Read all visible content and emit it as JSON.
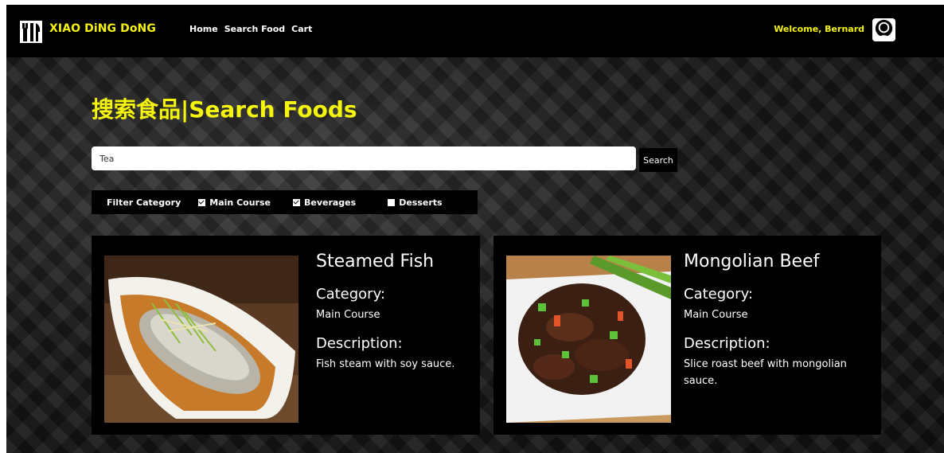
{
  "brand": {
    "name": "XIAO DiNG DoNG"
  },
  "nav": {
    "items": [
      "Home",
      "Search Food",
      "Cart"
    ]
  },
  "user": {
    "welcome": "Welcome, Bernard"
  },
  "page": {
    "title": "搜索食品|Search Foods"
  },
  "search": {
    "value": "Tea",
    "button_label": "Search"
  },
  "filter": {
    "label": "Filter Category",
    "options": [
      {
        "label": "Main Course",
        "checked": true
      },
      {
        "label": "Beverages",
        "checked": true
      },
      {
        "label": "Desserts",
        "checked": false
      }
    ]
  },
  "foods": [
    {
      "name": "Steamed Fish",
      "category_heading": "Category:",
      "category": "Main Course",
      "description_heading": "Description:",
      "description": "Fish steam with soy sauce."
    },
    {
      "name": "Mongolian Beef",
      "category_heading": "Category:",
      "category": "Main Course",
      "description_heading": "Description:",
      "description": "Slice roast beef with mongolian sauce."
    }
  ],
  "colors": {
    "accent": "#f4f40c",
    "nav_bg": "#000000"
  }
}
